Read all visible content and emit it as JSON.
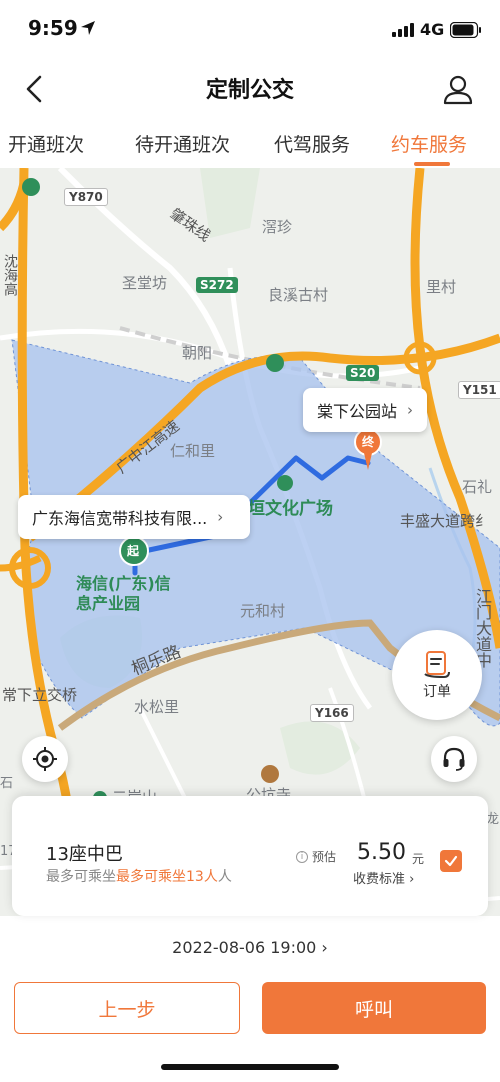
{
  "status_bar": {
    "time": "9:59",
    "network": "4G"
  },
  "header": {
    "title": "定制公交"
  },
  "tabs": [
    {
      "label": "开通班次",
      "active": false
    },
    {
      "label": "待开通班次",
      "active": false
    },
    {
      "label": "代驾服务",
      "active": false
    },
    {
      "label": "约车服务",
      "active": true
    }
  ],
  "map": {
    "labels": {
      "y870": "Y870",
      "zhaozhu": "肇珠线",
      "lanzhen": "滘珍",
      "shengtang": "圣堂坊",
      "s272": "S272",
      "liangxi": "良溪古村",
      "licun": "里村",
      "chaoyang": "朝阳",
      "s20": "S20",
      "y151": "Y151",
      "renhe": "仁和里",
      "guangzhong": "广中江高速",
      "shili": "石礼",
      "fengsheng": "丰盛大道跨纟",
      "plaza": "垣文化广场",
      "haixin": "海信(广东)信\n息产业园",
      "yuanhe": "元和村",
      "jiangmen": "江门大道中",
      "tongle": "桐乐路",
      "changxia_bridge": "常下立交桥",
      "shuisong": "水松里",
      "y166": "Y166",
      "gongkeng": "公坑寺",
      "er": "二岸山",
      "left_vert": "沈海高",
      "label_17": "17",
      "label_long": "龙",
      "label_shi": "石",
      "label_qi": "起",
      "label_zhong": "终"
    },
    "end_bubble": "棠下公园站",
    "start_bubble": "广东海信宽带科技有限...",
    "order_label": "订单"
  },
  "vehicle": {
    "name": "13座中巴",
    "capacity_prefix": "最多可乘坐",
    "capacity_highlight": "最多可乘坐13人",
    "capacity_suffix": "人",
    "estimate_label": "预估",
    "price": "5.50",
    "unit": "元",
    "fee_standard": "收费标准 ›",
    "selected": true
  },
  "datetime": "2022-08-06 19:00 ›",
  "buttons": {
    "prev": "上一步",
    "call": "呼叫"
  },
  "colors": {
    "accent": "#f0773a",
    "zone": "#a9c3ee",
    "route": "#2f6be0",
    "road": "#f5a623"
  }
}
